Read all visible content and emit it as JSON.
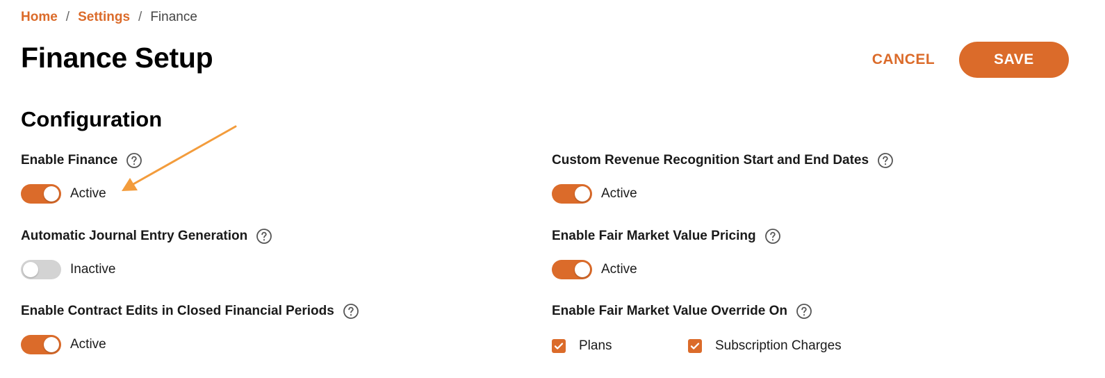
{
  "breadcrumb": {
    "home": "Home",
    "settings": "Settings",
    "current": "Finance",
    "separator": "/"
  },
  "page": {
    "title": "Finance Setup",
    "cancel_label": "CANCEL",
    "save_label": "SAVE"
  },
  "section": {
    "title": "Configuration"
  },
  "settings": {
    "enable_finance": {
      "label": "Enable Finance",
      "enabled": true,
      "status": "Active"
    },
    "journal_entry": {
      "label": "Automatic Journal Entry Generation",
      "enabled": false,
      "status": "Inactive"
    },
    "contract_edits": {
      "label": "Enable Contract Edits in Closed Financial Periods",
      "enabled": true,
      "status": "Active"
    },
    "revenue_dates": {
      "label": "Custom Revenue Recognition Start and End Dates",
      "enabled": true,
      "status": "Active"
    },
    "fmv_pricing": {
      "label": "Enable Fair Market Value Pricing",
      "enabled": true,
      "status": "Active"
    },
    "fmv_override": {
      "label": "Enable Fair Market Value Override On",
      "options": [
        {
          "label": "Plans",
          "checked": true
        },
        {
          "label": "Subscription Charges",
          "checked": true
        }
      ]
    }
  },
  "icons": {
    "help": "help-circle-icon",
    "check": "checkmark-icon",
    "annotation": "annotation-arrow"
  },
  "colors": {
    "accent": "#db6b2a",
    "toggle_off": "#d3d3d3",
    "annotation_arrow": "#f39c3c",
    "help_icon": "#555555"
  }
}
